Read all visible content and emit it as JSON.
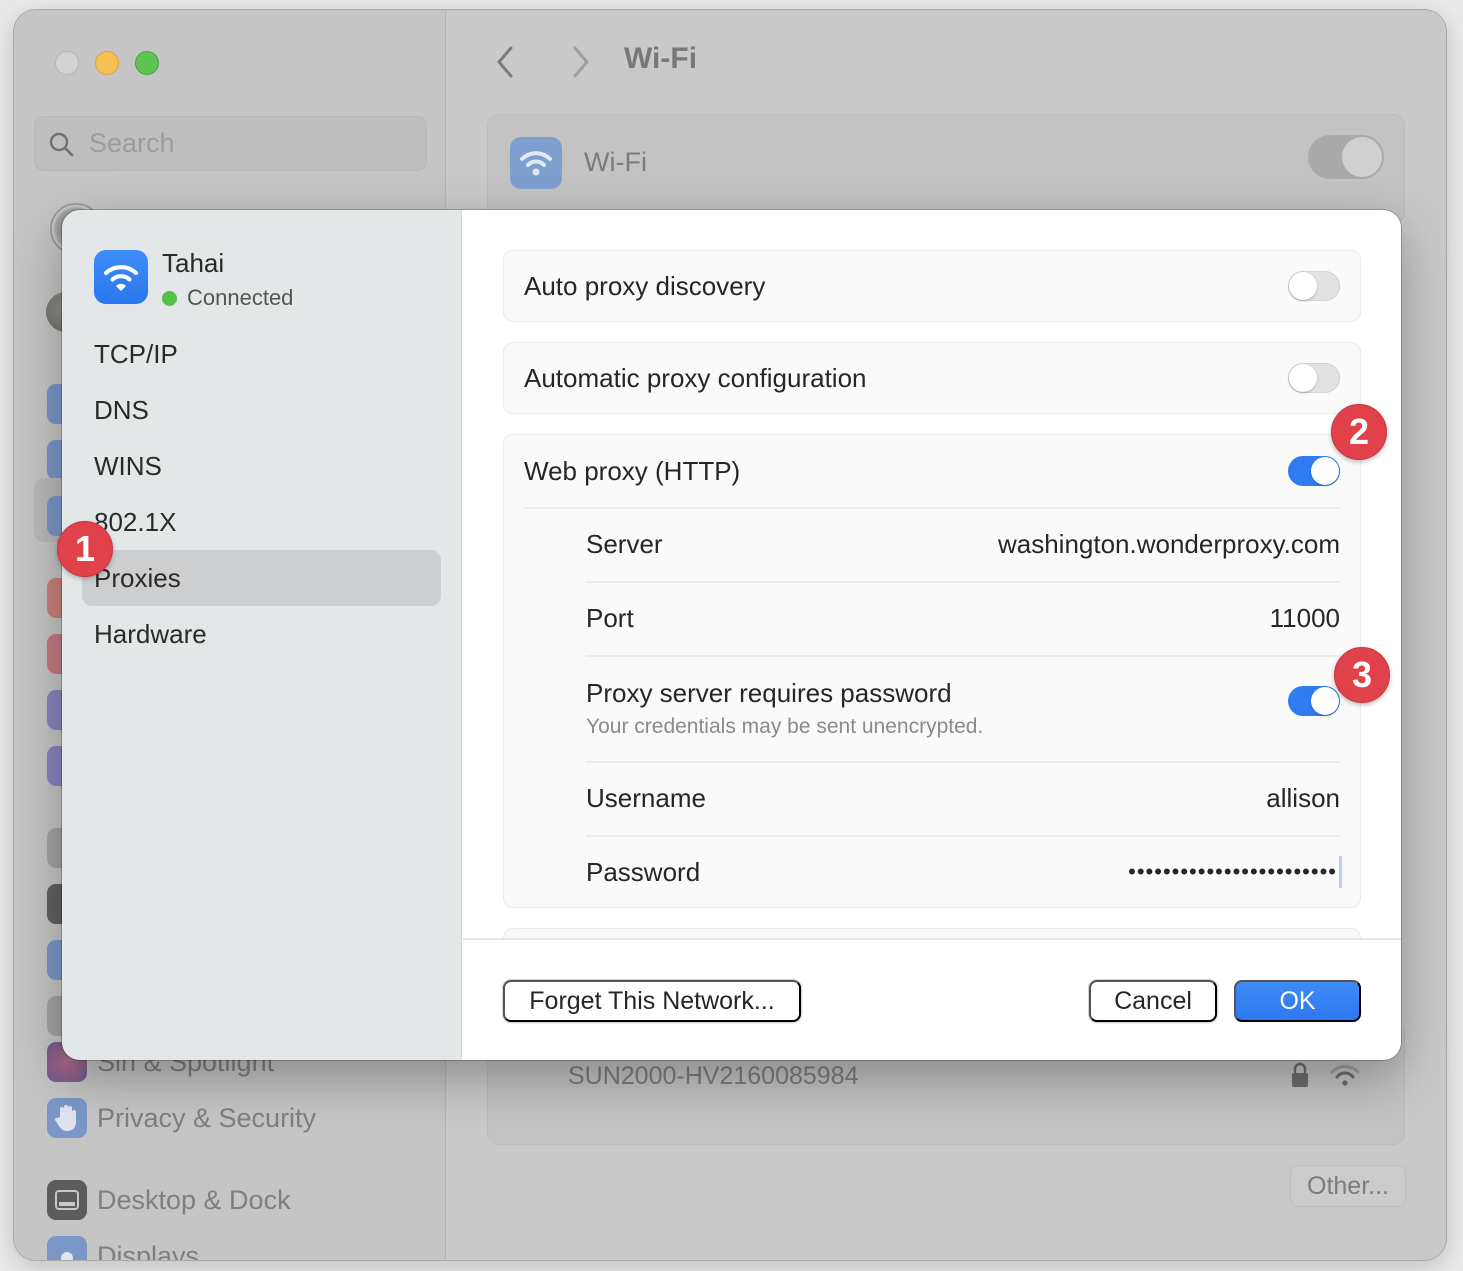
{
  "window": {
    "title": "Wi-Fi",
    "search_placeholder": "Search"
  },
  "background_sidebar": {
    "items": [
      {
        "label": "Siri & Spotlight",
        "icon": "siri-icon"
      },
      {
        "label": "Privacy & Security",
        "icon": "hand-icon"
      },
      {
        "label": "Desktop & Dock",
        "icon": "dock-icon"
      },
      {
        "label": "Displays",
        "icon": "sun-icon"
      }
    ]
  },
  "background_main": {
    "wifi_label": "Wi-Fi",
    "wifi_enabled": true,
    "other_network": {
      "name": "SUN2000-HV2160085984",
      "secured": true
    },
    "other_button": "Other..."
  },
  "sheet": {
    "network": {
      "name": "Tahai",
      "status": "Connected",
      "status_color": "#54c244"
    },
    "sidebar": {
      "items": [
        {
          "label": "TCP/IP",
          "active": false
        },
        {
          "label": "DNS",
          "active": false
        },
        {
          "label": "WINS",
          "active": false
        },
        {
          "label": "802.1X",
          "active": false
        },
        {
          "label": "Proxies",
          "active": true
        },
        {
          "label": "Hardware",
          "active": false
        }
      ]
    },
    "proxies": {
      "auto_discovery": {
        "label": "Auto proxy discovery",
        "enabled": false
      },
      "auto_config": {
        "label": "Automatic proxy configuration",
        "enabled": false
      },
      "web_proxy": {
        "label": "Web proxy (HTTP)",
        "enabled": true,
        "server_label": "Server",
        "server_value": "washington.wonderproxy.com",
        "port_label": "Port",
        "port_value": "11000",
        "requires_password_label": "Proxy server requires password",
        "requires_password_note": "Your credentials may be sent unencrypted.",
        "requires_password": true,
        "username_label": "Username",
        "username_value": "allison",
        "password_label": "Password",
        "password_value": "••••••••••••••••••••••••"
      }
    },
    "footer": {
      "forget_label": "Forget This Network...",
      "cancel_label": "Cancel",
      "ok_label": "OK"
    }
  },
  "annotations": {
    "badges": [
      "1",
      "2",
      "3"
    ],
    "badge_color": "#e0414a"
  },
  "colors": {
    "accent": "#2f7bf2",
    "badge": "#e0414a"
  }
}
